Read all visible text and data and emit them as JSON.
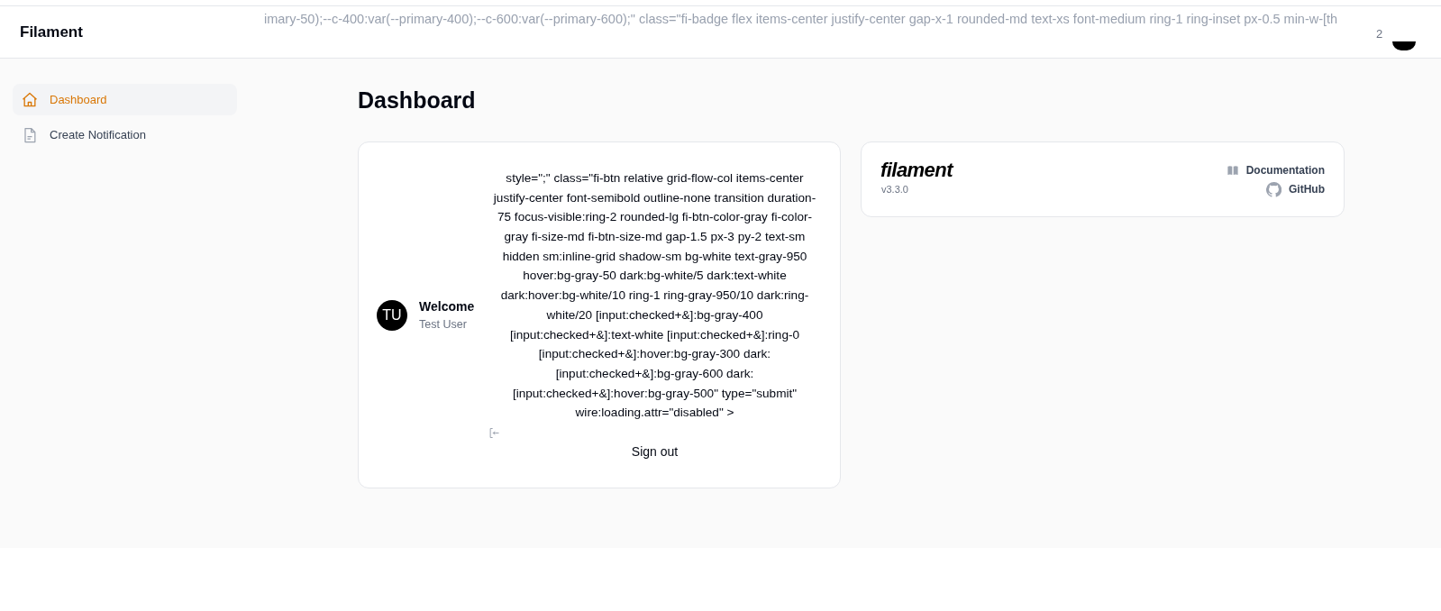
{
  "topbar": {
    "brand": "Filament",
    "stray_text": "imary-50);--c-400:var(--primary-400);--c-600:var(--primary-600);\" class=\"fi-badge flex items-center justify-center gap-x-1 rounded-md text-xs font-medium ring-1 ring-inset px-0.5 min-w-[th",
    "badge": "2"
  },
  "sidebar": {
    "items": [
      {
        "label": "Dashboard",
        "kind": "home",
        "selected": true
      },
      {
        "label": "Create Notification",
        "kind": "document",
        "selected": false
      }
    ]
  },
  "heading": "Dashboard",
  "account_widget": {
    "initials": "TU",
    "title": "Welcome",
    "name": "Test User",
    "stray_markup": "style=\";\" class=\"fi-btn relative grid-flow-col items-center justify-center font-semibold outline-none transition duration-75 focus-visible:ring-2 rounded-lg fi-btn-color-gray fi-color-gray fi-size-md fi-btn-size-md gap-1.5 px-3 py-2 text-sm hidden sm:inline-grid shadow-sm bg-white text-gray-950 hover:bg-gray-50 dark:bg-white/5 dark:text-white dark:hover:bg-white/10 ring-1 ring-gray-950/10 dark:ring-white/20 [input:checked+&]:bg-gray-400 [input:checked+&]:text-white [input:checked+&]:ring-0 [input:checked+&]:hover:bg-gray-300 dark:[input:checked+&]:bg-gray-600 dark:[input:checked+&]:hover:bg-gray-500\" type=\"submit\" wire:loading.attr=\"disabled\" >",
    "button_label": "Sign out"
  },
  "info_widget": {
    "logo": "filament",
    "version": "v3.3.0",
    "links": [
      {
        "label": "Documentation",
        "kind": "book"
      },
      {
        "label": "GitHub",
        "kind": "github"
      }
    ]
  }
}
